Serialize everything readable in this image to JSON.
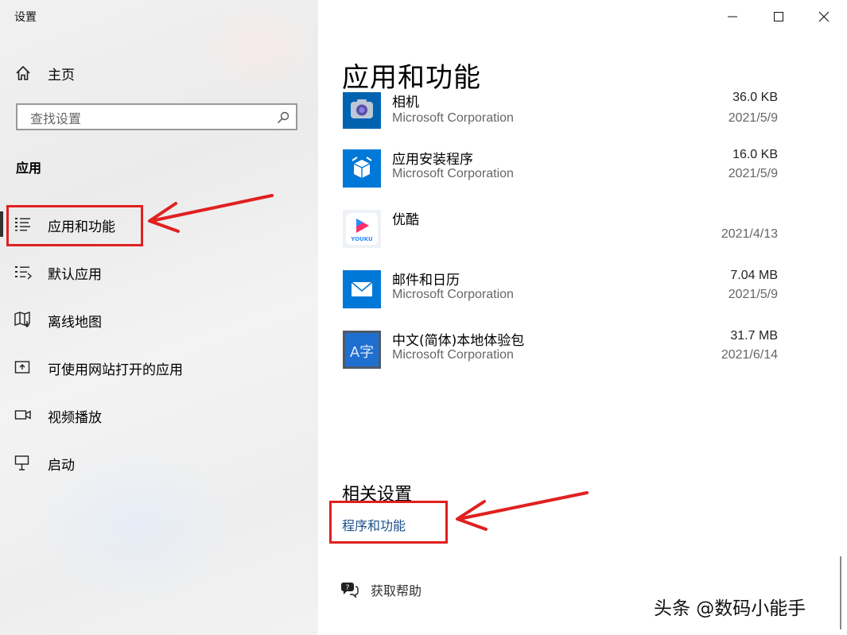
{
  "window": {
    "title": "设置"
  },
  "sidebar": {
    "home_label": "主页",
    "search_placeholder": "查找设置",
    "section_label": "应用",
    "items": [
      {
        "label": "应用和功能",
        "icon": "apps-list-icon",
        "selected": true
      },
      {
        "label": "默认应用",
        "icon": "default-apps-icon"
      },
      {
        "label": "离线地图",
        "icon": "offline-map-icon"
      },
      {
        "label": "可使用网站打开的应用",
        "icon": "web-app-icon"
      },
      {
        "label": "视频播放",
        "icon": "video-icon"
      },
      {
        "label": "启动",
        "icon": "startup-icon"
      }
    ]
  },
  "main": {
    "title": "应用和功能",
    "apps": [
      {
        "name": "相机",
        "publisher": "Microsoft Corporation",
        "size": "36.0 KB",
        "date": "2021/5/9",
        "icon": "camera-icon",
        "color": "#0063B1"
      },
      {
        "name": "应用安装程序",
        "publisher": "Microsoft Corporation",
        "size": "16.0 KB",
        "date": "2021/5/9",
        "icon": "app-installer-icon",
        "color": "#0078D7"
      },
      {
        "name": "优酷",
        "publisher": "",
        "size": "",
        "date": "2021/4/13",
        "icon": "youku-icon",
        "color": "#ffffff",
        "icon_text": "YOUKU"
      },
      {
        "name": "邮件和日历",
        "publisher": "Microsoft Corporation",
        "size": "7.04 MB",
        "date": "2021/5/9",
        "icon": "mail-icon",
        "color": "#0078D7"
      },
      {
        "name": "中文(简体)本地体验包",
        "publisher": "Microsoft Corporation",
        "size": "31.7 MB",
        "date": "2021/6/14",
        "icon": "language-pack-icon",
        "color": "#4C5A6B",
        "icon_text": "A字"
      }
    ],
    "related_title": "相关设置",
    "related_link": "程序和功能",
    "help_label": "获取帮助"
  },
  "watermark": "头条 @数码小能手",
  "colors": {
    "highlight_red": "#E02020",
    "link_blue": "#1A4F8A"
  }
}
